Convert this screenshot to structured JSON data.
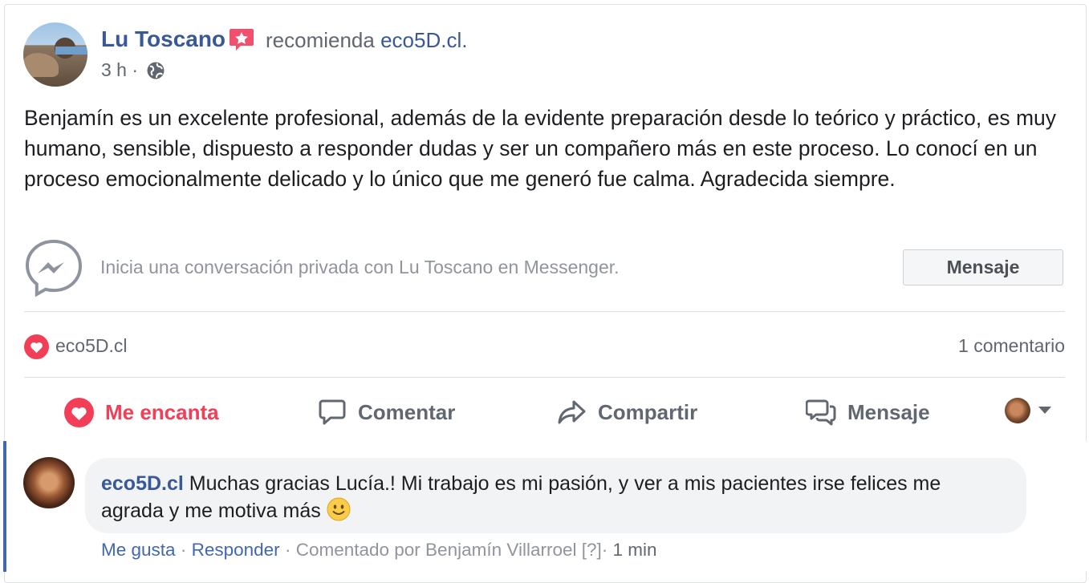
{
  "post": {
    "author": "Lu Toscano",
    "recommends_word": "recomienda",
    "page_name": "eco5D.cl.",
    "time": "3 h",
    "separator": "·",
    "text": "Benjamín es un excelente profesional, además de la evidente preparación desde lo teórico y práctico, es muy humano, sensible, dispuesto a responder dudas y ser un compañero más en este proceso. Lo conocí en un proceso emocionalmente delicado y lo único que me generó fue calma. Agradecida siempre."
  },
  "messenger": {
    "prompt": "Inicia una conversación privada con Lu Toscano en Messenger.",
    "button_label": "Mensaje"
  },
  "reactions": {
    "reactor": "eco5D.cl",
    "comment_count": "1 comentario"
  },
  "actions": {
    "love": "Me encanta",
    "comment": "Comentar",
    "share": "Compartir",
    "message": "Mensaje"
  },
  "comment": {
    "author": "eco5D.cl",
    "text": "Muchas gracias Lucía.! Mi trabajo es mi pasión, y ver a mis pacientes irse felices me agrada y me motiva más",
    "like_label": "Me gusta",
    "reply_label": "Responder",
    "commented_by": "Comentado por Benjamín Villarroel",
    "help_marker": "[?]",
    "time": "1 min",
    "separator": "·"
  },
  "colors": {
    "link_blue": "#385898",
    "love_red": "#f33e58",
    "muted": "#606770",
    "bubble_bg": "#f2f3f5",
    "accent_bar": "#4267b2"
  },
  "icons": [
    "recommend-badge-icon",
    "globe-icon",
    "messenger-icon",
    "love-reaction-icon",
    "heart-icon",
    "comment-icon",
    "share-icon",
    "message-icon",
    "chevron-down-icon",
    "smile-emoji-icon"
  ]
}
